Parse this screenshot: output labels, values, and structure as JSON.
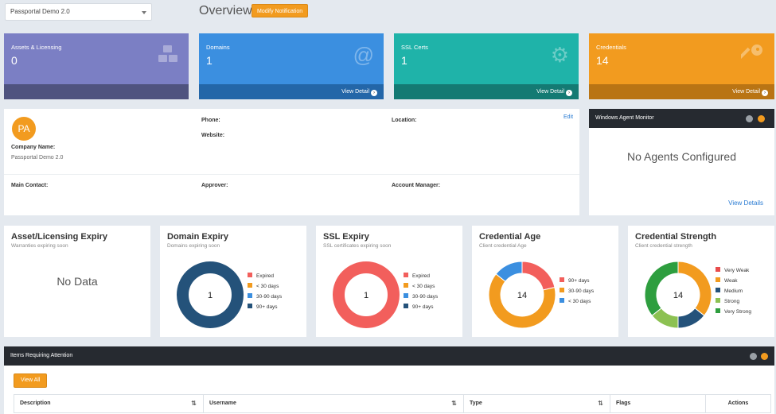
{
  "company_select": {
    "value": "Passportal Demo 2.0"
  },
  "header": {
    "title": "Overview",
    "modify_label": "Modify Notification"
  },
  "tiles": [
    {
      "title": "Assets & Licensing",
      "value": "0",
      "icon": "cubes-icon",
      "footer": "",
      "color": "#7b7fc4",
      "footer_color": "#4f537f"
    },
    {
      "title": "Domains",
      "value": "1",
      "icon": "at-icon",
      "footer": "View Detail",
      "color": "#3b8fe0",
      "footer_color": "#2366a8"
    },
    {
      "title": "SSL Certs",
      "value": "1",
      "icon": "gear-icon",
      "footer": "View Detail",
      "color": "#1fb3a9",
      "footer_color": "#147a73"
    },
    {
      "title": "Credentials",
      "value": "14",
      "icon": "key-icon",
      "footer": "View Detail",
      "color": "#f29b1f",
      "footer_color": "#b97414"
    }
  ],
  "company": {
    "avatar": "PA",
    "edit": "Edit",
    "name_label": "Company Name:",
    "name_value": "Passportal Demo 2.0",
    "phone_label": "Phone:",
    "website_label": "Website:",
    "location_label": "Location:",
    "main_contact_label": "Main Contact:",
    "approver_label": "Approver:",
    "account_manager_label": "Account Manager:"
  },
  "agent_monitor": {
    "title": "Windows Agent Monitor",
    "message": "No Agents Configured",
    "link": "View Details"
  },
  "charts": [
    {
      "title": "Asset/Licensing Expiry",
      "subtitle": "Warranties expiring soon",
      "no_data": "No Data"
    },
    {
      "title": "Domain Expiry",
      "subtitle": "Domains expiring soon",
      "center": "1"
    },
    {
      "title": "SSL Expiry",
      "subtitle": "SSL certificates expiring soon",
      "center": "1"
    },
    {
      "title": "Credential Age",
      "subtitle": "Client credential Age",
      "center": "14"
    },
    {
      "title": "Credential Strength",
      "subtitle": "Client credential strength",
      "center": "14"
    }
  ],
  "chart_data": [
    {
      "type": "pie",
      "title": "Domain Expiry",
      "categories": [
        "Expired",
        "< 30 days",
        "30-90 days",
        "90+ days"
      ],
      "values": [
        0,
        0,
        0,
        1
      ],
      "colors": [
        "#f25f5c",
        "#f29b1f",
        "#3b8fe0",
        "#24527a"
      ]
    },
    {
      "type": "pie",
      "title": "SSL Expiry",
      "categories": [
        "Expired",
        "< 30 days",
        "30-90 days",
        "90+ days"
      ],
      "values": [
        1,
        0,
        0,
        0
      ],
      "colors": [
        "#f25f5c",
        "#f29b1f",
        "#3b8fe0",
        "#24527a"
      ]
    },
    {
      "type": "pie",
      "title": "Credential Age",
      "categories": [
        "90+ days",
        "30-90 days",
        "< 30 days"
      ],
      "values": [
        3,
        9,
        2
      ],
      "colors": [
        "#f25f5c",
        "#f29b1f",
        "#3b8fe0"
      ]
    },
    {
      "type": "pie",
      "title": "Credential Strength",
      "categories": [
        "Very Weak",
        "Weak",
        "Medium",
        "Strong",
        "Very Strong"
      ],
      "values": [
        0,
        5,
        2,
        2,
        5
      ],
      "colors": [
        "#e84c4c",
        "#f29b1f",
        "#24527a",
        "#8cc152",
        "#2e9e3f"
      ]
    }
  ],
  "items": {
    "title": "Items Requiring Attention",
    "view_all": "View All",
    "columns": [
      "Description",
      "Username",
      "Type",
      "Flags",
      "Actions"
    ]
  }
}
